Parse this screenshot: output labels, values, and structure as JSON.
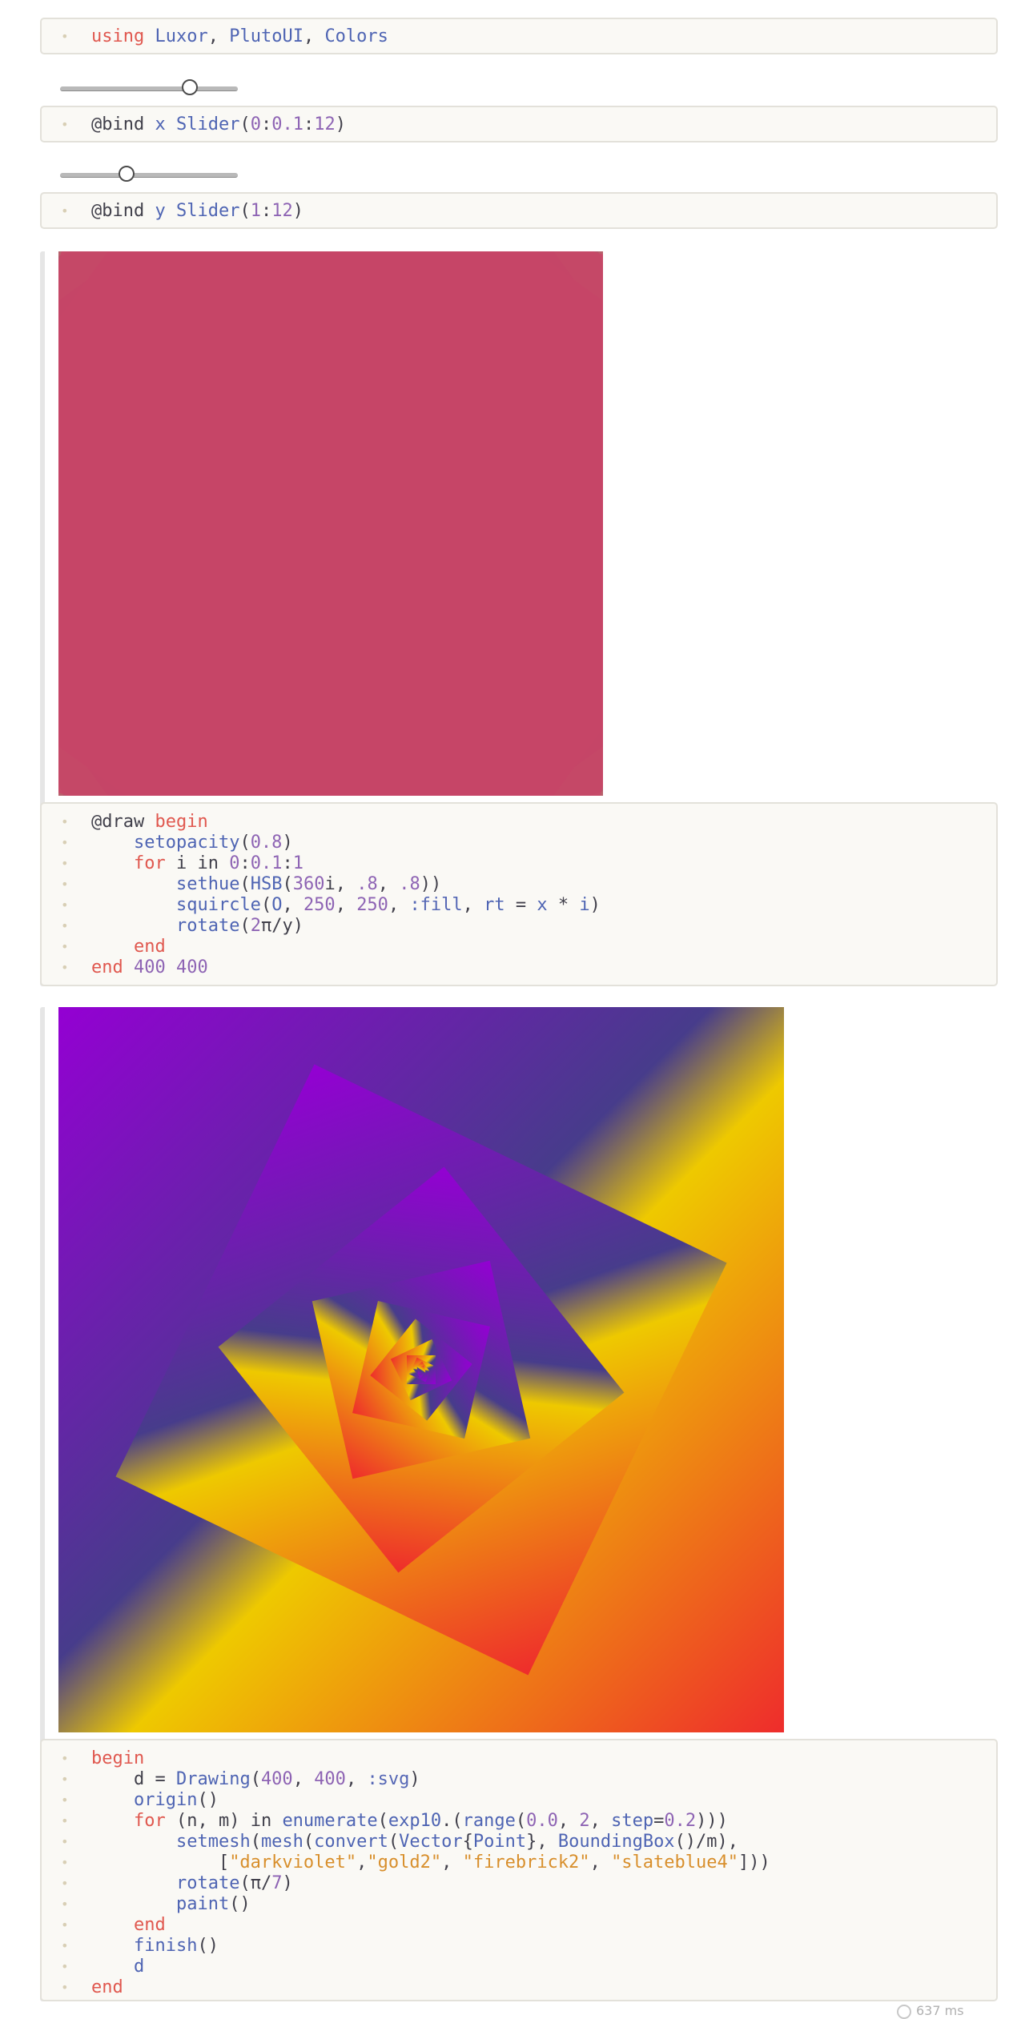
{
  "cells": {
    "using": {
      "line": [
        {
          "t": "using",
          "c": "kw"
        },
        {
          "t": " "
        },
        {
          "t": "Luxor",
          "c": "fn"
        },
        {
          "t": ", "
        },
        {
          "t": "PlutoUI",
          "c": "fn"
        },
        {
          "t": ", "
        },
        {
          "t": "Colors",
          "c": "fn"
        }
      ]
    },
    "slider_x": {
      "value_fraction": 0.75,
      "line": [
        {
          "t": "@bind "
        },
        {
          "t": "x",
          "c": "fn"
        },
        {
          "t": " "
        },
        {
          "t": "Slider",
          "c": "fn"
        },
        {
          "t": "("
        },
        {
          "t": "0",
          "c": "num"
        },
        {
          "t": ":"
        },
        {
          "t": "0.1",
          "c": "num"
        },
        {
          "t": ":"
        },
        {
          "t": "12",
          "c": "num"
        },
        {
          "t": ")"
        }
      ]
    },
    "slider_y": {
      "value_fraction": 0.36,
      "line": [
        {
          "t": "@bind "
        },
        {
          "t": "y",
          "c": "fn"
        },
        {
          "t": " "
        },
        {
          "t": "Slider",
          "c": "fn"
        },
        {
          "t": "("
        },
        {
          "t": "1",
          "c": "num"
        },
        {
          "t": ":"
        },
        {
          "t": "12",
          "c": "num"
        },
        {
          "t": ")"
        }
      ]
    },
    "star": {
      "lines": [
        [
          {
            "t": "@draw "
          },
          {
            "t": "begin",
            "c": "kw"
          }
        ],
        [
          {
            "t": "    "
          },
          {
            "t": "setopacity",
            "c": "fn"
          },
          {
            "t": "("
          },
          {
            "t": "0.8",
            "c": "num"
          },
          {
            "t": ")"
          }
        ],
        [
          {
            "t": "    "
          },
          {
            "t": "for",
            "c": "kw"
          },
          {
            "t": " i in "
          },
          {
            "t": "0",
            "c": "num"
          },
          {
            "t": ":"
          },
          {
            "t": "0.1",
            "c": "num"
          },
          {
            "t": ":"
          },
          {
            "t": "1",
            "c": "num"
          }
        ],
        [
          {
            "t": "        "
          },
          {
            "t": "sethue",
            "c": "fn"
          },
          {
            "t": "("
          },
          {
            "t": "HSB",
            "c": "fn"
          },
          {
            "t": "("
          },
          {
            "t": "360",
            "c": "num"
          },
          {
            "t": "i, "
          },
          {
            "t": ".8",
            "c": "num"
          },
          {
            "t": ", "
          },
          {
            "t": ".8",
            "c": "num"
          },
          {
            "t": "))"
          }
        ],
        [
          {
            "t": "        "
          },
          {
            "t": "squircle",
            "c": "fn"
          },
          {
            "t": "("
          },
          {
            "t": "O",
            "c": "fn"
          },
          {
            "t": ", "
          },
          {
            "t": "250",
            "c": "num"
          },
          {
            "t": ", "
          },
          {
            "t": "250",
            "c": "num"
          },
          {
            "t": ", "
          },
          {
            "t": ":fill",
            "c": "sym"
          },
          {
            "t": ", "
          },
          {
            "t": "rt",
            "c": "fn"
          },
          {
            "t": " = "
          },
          {
            "t": "x",
            "c": "fn"
          },
          {
            "t": " * "
          },
          {
            "t": "i",
            "c": "fn"
          },
          {
            "t": ")"
          }
        ],
        [
          {
            "t": "        "
          },
          {
            "t": "rotate",
            "c": "fn"
          },
          {
            "t": "("
          },
          {
            "t": "2",
            "c": "num"
          },
          {
            "t": "π/y)"
          }
        ],
        [
          {
            "t": "    "
          },
          {
            "t": "end",
            "c": "kw"
          }
        ],
        [
          {
            "t": "end",
            "c": "kw"
          },
          {
            "t": " "
          },
          {
            "t": "400",
            "c": "num"
          },
          {
            "t": " "
          },
          {
            "t": "400",
            "c": "num"
          }
        ]
      ]
    },
    "spiral": {
      "colors": [
        "darkviolet",
        "gold2",
        "firebrick2",
        "slateblue4"
      ],
      "lines": [
        [
          {
            "t": "begin",
            "c": "kw"
          }
        ],
        [
          {
            "t": "    d = "
          },
          {
            "t": "Drawing",
            "c": "fn"
          },
          {
            "t": "("
          },
          {
            "t": "400",
            "c": "num"
          },
          {
            "t": ", "
          },
          {
            "t": "400",
            "c": "num"
          },
          {
            "t": ", "
          },
          {
            "t": ":svg",
            "c": "sym"
          },
          {
            "t": ")"
          }
        ],
        [
          {
            "t": "    "
          },
          {
            "t": "origin",
            "c": "fn"
          },
          {
            "t": "()"
          }
        ],
        [
          {
            "t": "    "
          },
          {
            "t": "for",
            "c": "kw"
          },
          {
            "t": " (n, m) in "
          },
          {
            "t": "enumerate",
            "c": "fn"
          },
          {
            "t": "("
          },
          {
            "t": "exp10",
            "c": "fn"
          },
          {
            "t": ".("
          },
          {
            "t": "range",
            "c": "fn"
          },
          {
            "t": "("
          },
          {
            "t": "0.0",
            "c": "num"
          },
          {
            "t": ", "
          },
          {
            "t": "2",
            "c": "num"
          },
          {
            "t": ", "
          },
          {
            "t": "step",
            "c": "fn"
          },
          {
            "t": "="
          },
          {
            "t": "0.2",
            "c": "num"
          },
          {
            "t": ")))"
          }
        ],
        [
          {
            "t": "        "
          },
          {
            "t": "setmesh",
            "c": "fn"
          },
          {
            "t": "("
          },
          {
            "t": "mesh",
            "c": "fn"
          },
          {
            "t": "("
          },
          {
            "t": "convert",
            "c": "fn"
          },
          {
            "t": "("
          },
          {
            "t": "Vector",
            "c": "fn"
          },
          {
            "t": "{"
          },
          {
            "t": "Point",
            "c": "fn"
          },
          {
            "t": "}, "
          },
          {
            "t": "BoundingBox",
            "c": "fn"
          },
          {
            "t": "()/m),"
          }
        ],
        [
          {
            "t": "            ["
          },
          {
            "t": "\"darkviolet\"",
            "c": "str"
          },
          {
            "t": ","
          },
          {
            "t": "\"gold2\"",
            "c": "str"
          },
          {
            "t": ", "
          },
          {
            "t": "\"firebrick2\"",
            "c": "str"
          },
          {
            "t": ", "
          },
          {
            "t": "\"slateblue4\"",
            "c": "str"
          },
          {
            "t": "]))"
          }
        ],
        [
          {
            "t": "        "
          },
          {
            "t": "rotate",
            "c": "fn"
          },
          {
            "t": "(π/"
          },
          {
            "t": "7",
            "c": "num"
          },
          {
            "t": ")"
          }
        ],
        [
          {
            "t": "        "
          },
          {
            "t": "paint",
            "c": "fn"
          },
          {
            "t": "()"
          }
        ],
        [
          {
            "t": "    "
          },
          {
            "t": "end",
            "c": "kw"
          }
        ],
        [
          {
            "t": "    "
          },
          {
            "t": "finish",
            "c": "fn"
          },
          {
            "t": "()"
          }
        ],
        [
          {
            "t": "    d",
            "c": "fn"
          }
        ],
        [
          {
            "t": "end",
            "c": "kw"
          }
        ]
      ]
    }
  },
  "runtime": "637 ms",
  "theme": {
    "hsb_colors": [
      "#cc5c5c",
      "#cc8b45",
      "#b7bb45",
      "#6fc145",
      "#45c17b",
      "#45c1bd",
      "#4586c1",
      "#4549c1",
      "#8245c1",
      "#c145b9",
      "#cc4553"
    ],
    "mesh_hex": [
      "#9400d3",
      "#eec900",
      "#ee2c2c",
      "#473c8b"
    ]
  }
}
